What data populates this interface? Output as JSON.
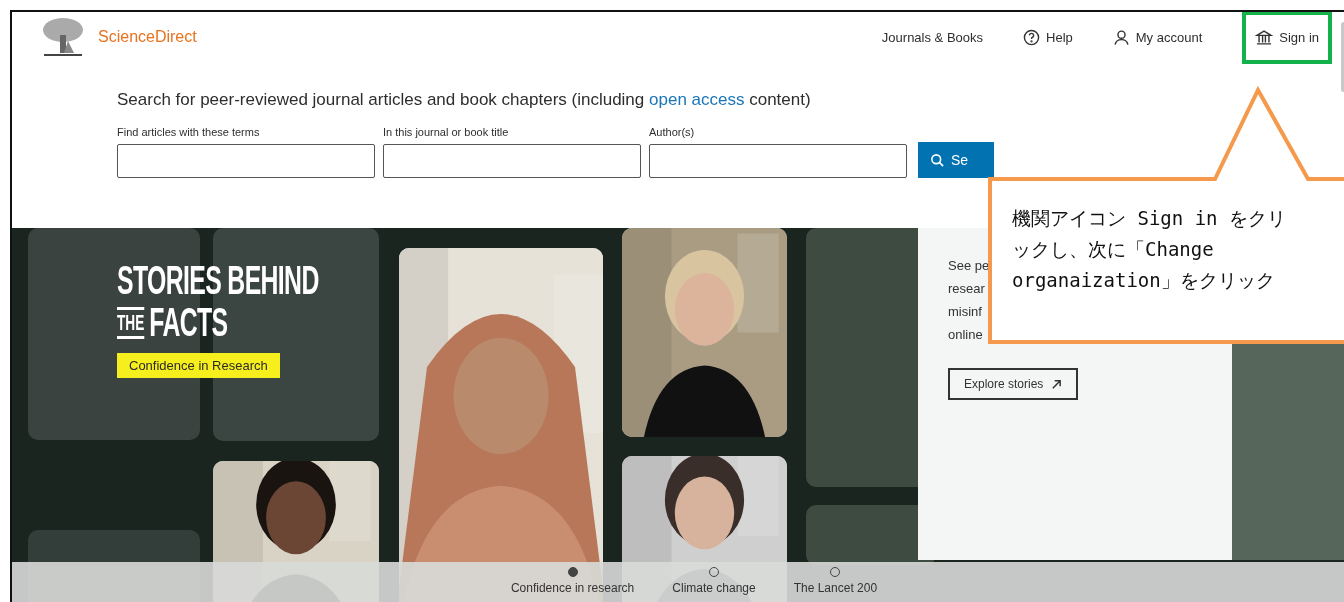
{
  "header": {
    "logo_text": "ScienceDirect",
    "nav": [
      {
        "label": "Journals & Books",
        "highlighted": false
      },
      {
        "label": "Help",
        "highlighted": false
      },
      {
        "label": "My account",
        "highlighted": false
      },
      {
        "label": "Sign in",
        "highlighted": true
      }
    ]
  },
  "search": {
    "heading_before": "Search for peer-reviewed journal articles and book chapters (including ",
    "heading_link": "open access",
    "heading_after": " content)",
    "fields": [
      {
        "label": "Find articles with these terms"
      },
      {
        "label": "In this journal or book title"
      },
      {
        "label": "Author(s)"
      }
    ],
    "button": "Se"
  },
  "hero": {
    "title_top": "STORIES BEHIND",
    "title_small": "THE",
    "title_bottom": "FACTS",
    "tag": "Confidence in Research",
    "card_lines": [
      "See pe",
      "resear",
      "misinf",
      "online"
    ],
    "card_button": "Explore stories",
    "carousel": [
      {
        "label": "Confidence in research",
        "selected": true
      },
      {
        "label": "Climate change",
        "selected": false
      },
      {
        "label": "The Lancet 200",
        "selected": false
      }
    ]
  },
  "callout": {
    "lines": [
      "機関アイコン Sign in をクリ",
      "ックし、次に「Change",
      "organaization」をクリック"
    ]
  }
}
